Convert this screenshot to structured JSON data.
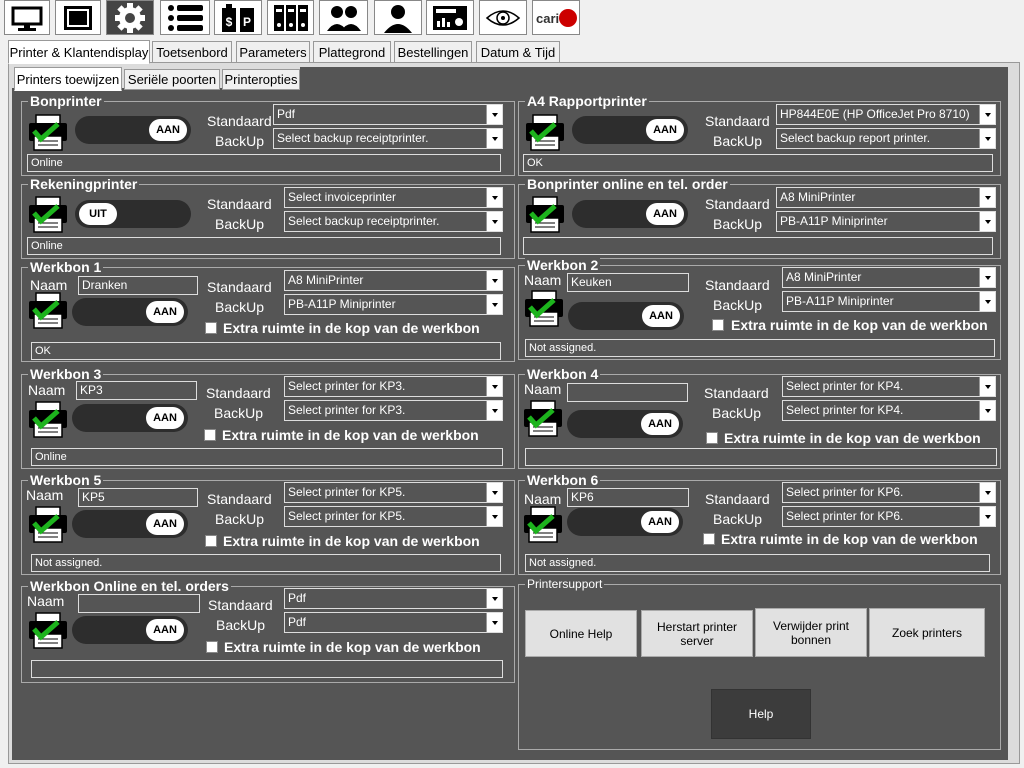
{
  "toolbar": {
    "icons": [
      "monitor-icon",
      "screen-icon",
      "gear-icon",
      "list-icon",
      "price-icon",
      "binders-icon",
      "users-icon",
      "user-icon",
      "report-icon",
      "eye-icon",
      "cariari-logo-icon"
    ],
    "logo_text": "cari"
  },
  "tabs": [
    "Printer & Klantendisplay",
    "Toetsenbord",
    "Parameters",
    "Plattegrond",
    "Bestellingen",
    "Datum & Tijd"
  ],
  "subtabs": [
    "Printers toewijzen",
    "Seriële poorten",
    "Printeropties"
  ],
  "labels": {
    "standaard": "Standaard",
    "backup": "BackUp",
    "naam": "Naam",
    "extra": "Extra ruimte in de kop van de werkbon"
  },
  "toggle": {
    "on": "AAN",
    "off": "UIT"
  },
  "groups": {
    "bonprinter": {
      "title": "Bonprinter",
      "standaard": "Pdf",
      "backup": "Select backup receiptprinter.",
      "status": "Online",
      "state": "AAN"
    },
    "a4": {
      "title": "A4 Rapportprinter",
      "standaard": "HP844E0E (HP OfficeJet Pro 8710)",
      "backup": "Select backup report printer.",
      "status": "OK",
      "state": "AAN"
    },
    "rekening": {
      "title": "Rekeningprinter",
      "standaard": "Select invoiceprinter",
      "backup": "Select backup receiptprinter.",
      "status": "Online",
      "state": "UIT"
    },
    "online_order": {
      "title": "Bonprinter online en tel. order",
      "standaard": "A8 MiniPrinter",
      "backup": "PB-A11P Miniprinter",
      "status": "",
      "state": "AAN"
    },
    "wb1": {
      "title": "Werkbon 1",
      "naam": "Dranken",
      "standaard": "A8 MiniPrinter",
      "backup": "PB-A11P Miniprinter",
      "status": "OK",
      "state": "AAN"
    },
    "wb2": {
      "title": "Werkbon 2",
      "naam": "Keuken",
      "standaard": "A8 MiniPrinter",
      "backup": "PB-A11P Miniprinter",
      "status": "Not assigned.",
      "state": "AAN"
    },
    "wb3": {
      "title": "Werkbon 3",
      "naam": "KP3",
      "standaard": "Select printer for KP3.",
      "backup": "Select printer for KP3.",
      "status": "Online",
      "state": "AAN"
    },
    "wb4": {
      "title": "Werkbon 4",
      "naam": "",
      "standaard": "Select printer for KP4.",
      "backup": "Select printer for KP4.",
      "status": "",
      "state": "AAN"
    },
    "wb5": {
      "title": "Werkbon 5",
      "naam": "KP5",
      "standaard": "Select printer for KP5.",
      "backup": "Select printer for KP5.",
      "status": "Not assigned.",
      "state": "AAN"
    },
    "wb6": {
      "title": "Werkbon 6",
      "naam": "KP6",
      "standaard": "Select printer for KP6.",
      "backup": "Select printer for KP6.",
      "status": "Not assigned.",
      "state": "AAN"
    },
    "wbo": {
      "title": "Werkbon Online en tel. orders",
      "naam": "",
      "standaard": "Pdf",
      "backup": "Pdf",
      "status": "",
      "state": "AAN"
    }
  },
  "support": {
    "title": "Printersupport",
    "online_help": "Online Help",
    "restart": "Herstart printer server",
    "delete": "Verwijder print bonnen",
    "search": "Zoek printers",
    "help": "Help"
  }
}
